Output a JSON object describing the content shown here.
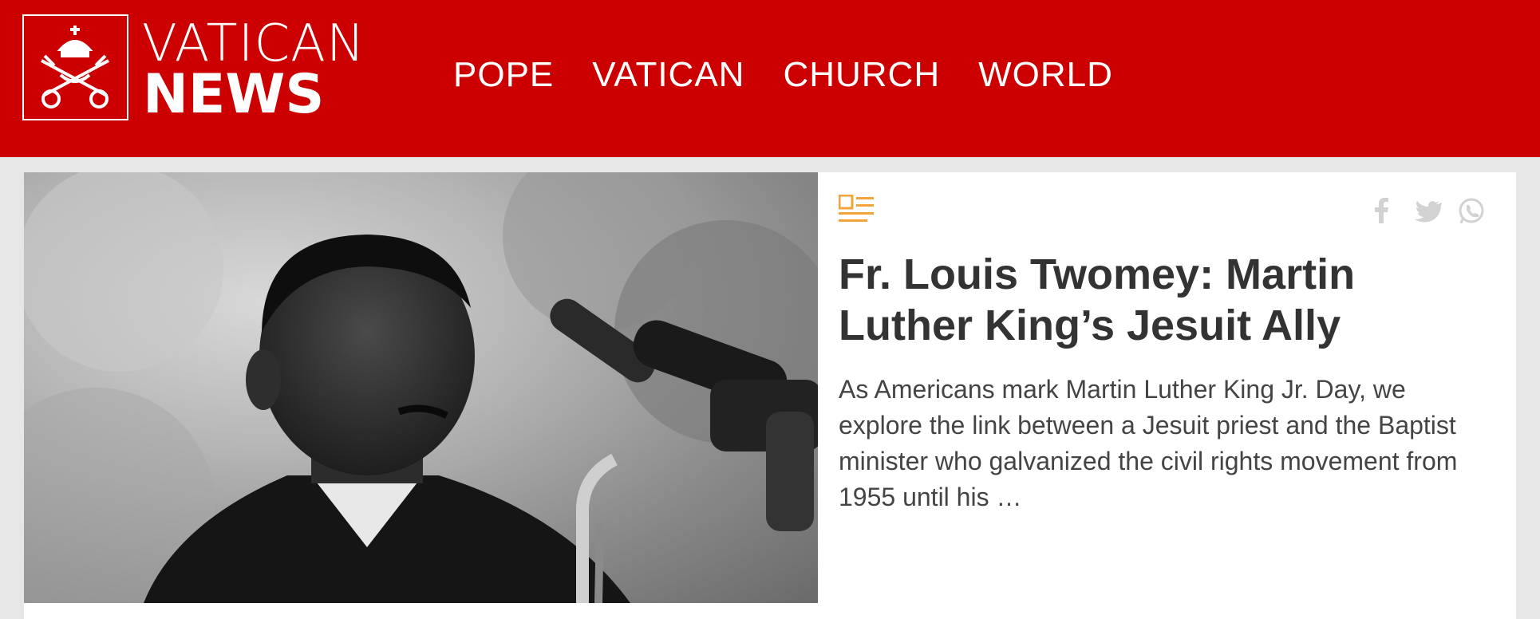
{
  "site": {
    "logo_top": "VATICAN",
    "logo_bottom": "NEWS",
    "brand_color": "#cc0000"
  },
  "nav": {
    "items": [
      {
        "label": "POPE"
      },
      {
        "label": "VATICAN"
      },
      {
        "label": "CHURCH"
      },
      {
        "label": "WORLD"
      }
    ]
  },
  "article": {
    "type_icon": "article-list-icon",
    "title": "Fr. Louis Twomey: Martin Luther King’s Jesuit Ally",
    "summary": "As Americans mark Martin Luther King Jr. Day, we explore the link between a Jesuit priest and the Baptist minister who galvanized the civil rights movement from 1955 until his …",
    "accent_color": "#f2a33a",
    "share_icons": [
      "facebook-icon",
      "twitter-icon",
      "whatsapp-icon"
    ]
  }
}
